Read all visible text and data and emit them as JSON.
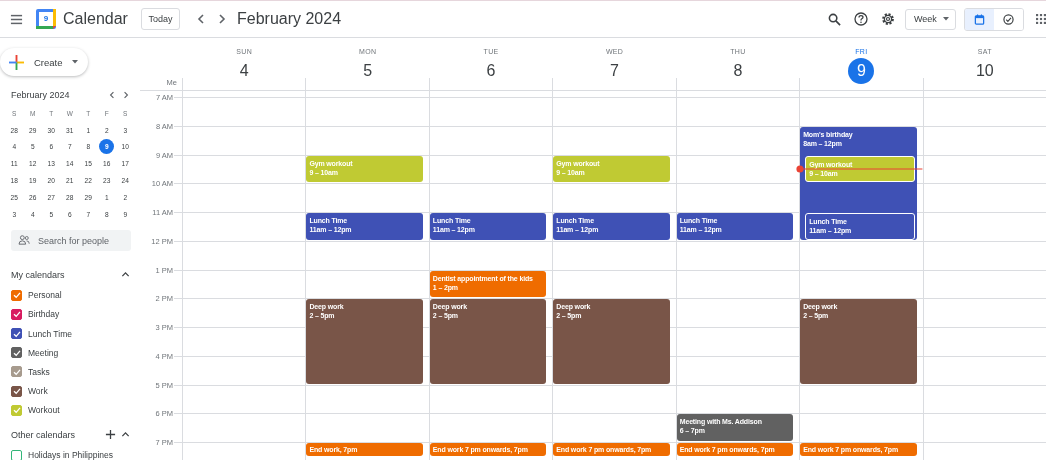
{
  "header": {
    "logo_day": "9",
    "title": "Calendar",
    "today_button": "Today",
    "period": "February 2024",
    "view_select": "Week",
    "view_toggles": [
      {
        "kind": "calendar",
        "selected": true
      },
      {
        "kind": "tasks",
        "selected": false
      }
    ]
  },
  "sidebar": {
    "create_button": "Create",
    "mini_calendar": {
      "title": "February 2024",
      "weekdays": [
        "S",
        "M",
        "T",
        "W",
        "T",
        "F",
        "S"
      ],
      "weeks": [
        [
          {
            "day": "28",
            "selected": false
          },
          {
            "day": "29",
            "selected": false
          },
          {
            "day": "30",
            "selected": false
          },
          {
            "day": "31",
            "selected": false
          },
          {
            "day": "1",
            "selected": false
          },
          {
            "day": "2",
            "selected": false
          },
          {
            "day": "3",
            "selected": false
          }
        ],
        [
          {
            "day": "4",
            "selected": false
          },
          {
            "day": "5",
            "selected": false
          },
          {
            "day": "6",
            "selected": false
          },
          {
            "day": "7",
            "selected": false
          },
          {
            "day": "8",
            "selected": false
          },
          {
            "day": "9",
            "selected": true
          },
          {
            "day": "10",
            "selected": false
          }
        ],
        [
          {
            "day": "11",
            "selected": false
          },
          {
            "day": "12",
            "selected": false
          },
          {
            "day": "13",
            "selected": false
          },
          {
            "day": "14",
            "selected": false
          },
          {
            "day": "15",
            "selected": false
          },
          {
            "day": "16",
            "selected": false
          },
          {
            "day": "17",
            "selected": false
          }
        ],
        [
          {
            "day": "18",
            "selected": false
          },
          {
            "day": "19",
            "selected": false
          },
          {
            "day": "20",
            "selected": false
          },
          {
            "day": "21",
            "selected": false
          },
          {
            "day": "22",
            "selected": false
          },
          {
            "day": "23",
            "selected": false
          },
          {
            "day": "24",
            "selected": false
          }
        ],
        [
          {
            "day": "25",
            "selected": false
          },
          {
            "day": "26",
            "selected": false
          },
          {
            "day": "27",
            "selected": false
          },
          {
            "day": "28",
            "selected": false
          },
          {
            "day": "29",
            "selected": false
          },
          {
            "day": "1",
            "selected": false
          },
          {
            "day": "2",
            "selected": false
          }
        ],
        [
          {
            "day": "3",
            "selected": false
          },
          {
            "day": "4",
            "selected": false
          },
          {
            "day": "5",
            "selected": false
          },
          {
            "day": "6",
            "selected": false
          },
          {
            "day": "7",
            "selected": false
          },
          {
            "day": "8",
            "selected": false
          },
          {
            "day": "9",
            "selected": false
          }
        ]
      ]
    },
    "search": {
      "placeholder": "Search for people"
    },
    "my_calendars": {
      "title": "My calendars",
      "expanded": true,
      "items": [
        {
          "label": "Personal",
          "checked": true,
          "color": "#ef6c00"
        },
        {
          "label": "Birthday",
          "checked": true,
          "color": "#d81b60"
        },
        {
          "label": "Lunch Time",
          "checked": true,
          "color": "#3f51b5"
        },
        {
          "label": "Meeting",
          "checked": true,
          "color": "#616161"
        },
        {
          "label": "Tasks",
          "checked": true,
          "color": "#a79b8e"
        },
        {
          "label": "Work",
          "checked": true,
          "color": "#795548"
        },
        {
          "label": "Workout",
          "checked": true,
          "color": "#c0ca33"
        }
      ]
    },
    "other_calendars": {
      "title": "Other calendars",
      "expanded": true,
      "items": [
        {
          "label": "Holidays in Philippines",
          "checked": false,
          "color": "#33b679"
        }
      ]
    }
  },
  "week": {
    "timezone_label": "Me",
    "hours": [
      "7 AM",
      "8 AM",
      "9 AM",
      "10 AM",
      "11 AM",
      "12 PM",
      "1 PM",
      "2 PM",
      "3 PM",
      "4 PM",
      "5 PM",
      "6 PM",
      "7 PM"
    ],
    "days": [
      {
        "name": "SUN",
        "date": "4",
        "today": false
      },
      {
        "name": "MON",
        "date": "5",
        "today": false,
        "events": [
          {
            "title": "Gym workout",
            "time": "9 – 10am",
            "color": "#c0ca33"
          },
          {
            "title": "Lunch Time",
            "time": "11am – 12pm",
            "color": "#3f51b5"
          },
          {
            "title": "Deep work",
            "time": "2 – 5pm",
            "color": "#795548"
          },
          {
            "title": "End work, 7pm",
            "color": "#ef6c00"
          }
        ]
      },
      {
        "name": "TUE",
        "date": "6",
        "today": false,
        "events": [
          {
            "title": "Lunch Time",
            "time": "11am – 12pm",
            "color": "#3f51b5"
          },
          {
            "title": "Dentist appointment of the kids",
            "time": "1 – 2pm",
            "color": "#ef6c00"
          },
          {
            "title": "Deep work",
            "time": "2 – 5pm",
            "color": "#795548"
          },
          {
            "title": "End work 7 pm onwards, 7pm",
            "color": "#ef6c00"
          }
        ]
      },
      {
        "name": "WED",
        "date": "7",
        "today": false,
        "events": [
          {
            "title": "Gym workout",
            "time": "9 – 10am",
            "color": "#c0ca33"
          },
          {
            "title": "Lunch Time",
            "time": "11am – 12pm",
            "color": "#3f51b5"
          },
          {
            "title": "Deep work",
            "time": "2 – 5pm",
            "color": "#795548"
          },
          {
            "title": "End work 7 pm onwards, 7pm",
            "color": "#ef6c00"
          }
        ]
      },
      {
        "name": "THU",
        "date": "8",
        "today": false,
        "events": [
          {
            "title": "Lunch Time",
            "time": "11am – 12pm",
            "color": "#3f51b5"
          },
          {
            "title": "Meeting with Ms. Addison",
            "time": "6 – 7pm",
            "color": "#616161"
          },
          {
            "title": "End work 7 pm onwards, 7pm",
            "color": "#ef6c00"
          }
        ]
      },
      {
        "name": "FRI",
        "date": "9",
        "today": true,
        "events": [
          {
            "title": "Mom's birthday",
            "time": "8am – 12pm",
            "color": "#3f51b5"
          },
          {
            "title": "Gym workout",
            "time": "9 – 10am",
            "color": "#c0ca33"
          },
          {
            "title": "Lunch Time",
            "time": "11am – 12pm",
            "color": "#3f51b5"
          },
          {
            "title": "Deep work",
            "time": "2 – 5pm",
            "color": "#795548"
          },
          {
            "title": "End work 7 pm onwards, 7pm",
            "color": "#ef6c00"
          }
        ]
      },
      {
        "name": "SAT",
        "date": "10",
        "today": false
      }
    ]
  }
}
